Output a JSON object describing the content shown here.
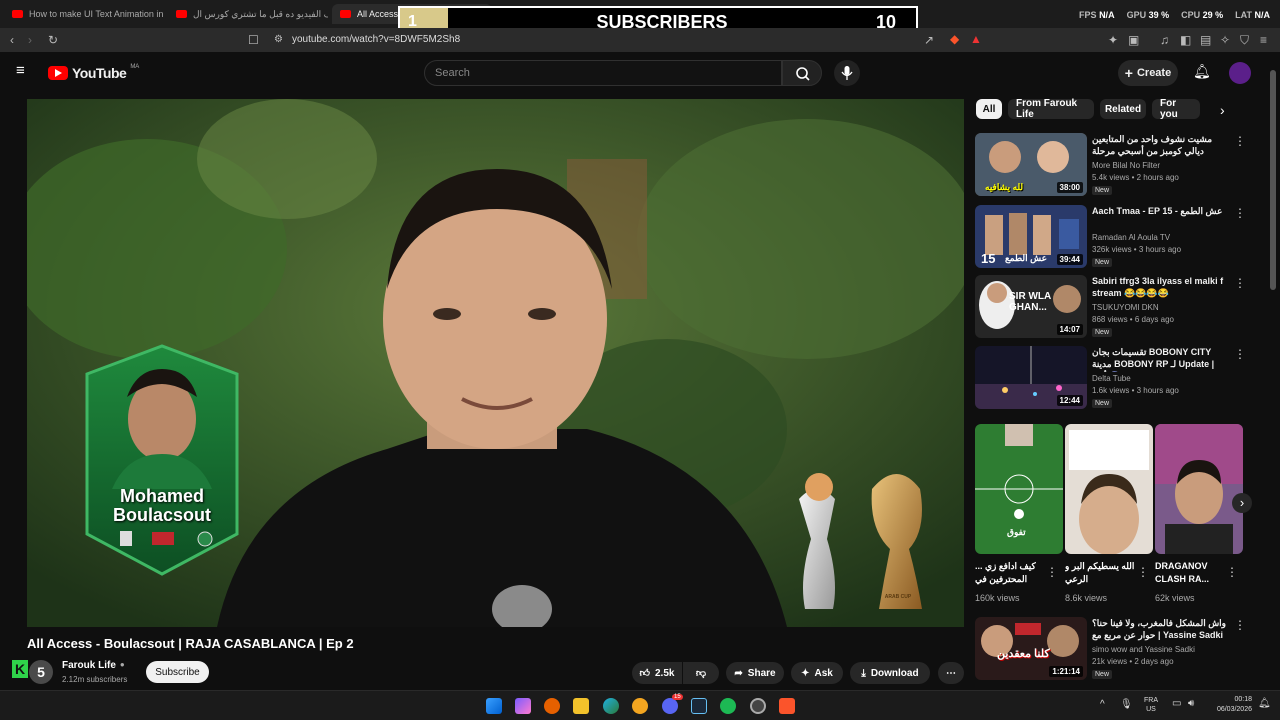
{
  "browser": {
    "tabs": [
      {
        "label": "How to make UI Text Animation in Af",
        "active": false
      },
      {
        "label": "شوف الفيديو ده قبل ما تشتري كورس ال",
        "active": false
      },
      {
        "label": "All Access - B... RAJA C",
        "active": true
      }
    ],
    "url": "youtube.com/watch?v=8DWF5M2Sh8"
  },
  "overlay": {
    "count": "1",
    "title": "SUBSCRIBERS",
    "goal": "10"
  },
  "perf": {
    "fps_label": "FPS",
    "fps_value": "N/A",
    "gpu_label": "GPU",
    "gpu_value": "39 %",
    "cpu_label": "CPU",
    "cpu_value": "29 %",
    "lat_label": "LAT",
    "lat_value": "N/A"
  },
  "masthead": {
    "logo": "YouTube",
    "country": "MA",
    "search_placeholder": "Search",
    "create_label": "Create"
  },
  "video": {
    "title": "All Access - Boulacsout | RAJA CASABLANCA | Ep 2",
    "player_card_name": "Mohamed Boulacsout",
    "trophy_label": "ARAB CUP",
    "channel_name": "Farouk Life",
    "subscribers": "2.12m subscribers",
    "subscribe_label": "Subscribe",
    "likes": "2.5k",
    "share_label": "Share",
    "ask_label": "Ask",
    "download_label": "Download",
    "avatar_badge": "5"
  },
  "sidebar": {
    "chips": [
      "All",
      "From Farouk Life",
      "Related",
      "For you"
    ],
    "recommendations": [
      {
        "title": "مشيت نشوف واحد من المتابعين ديالي كومبز من أسبحي مرحلة خطيرة",
        "channel": "More Bilal No Filter",
        "meta": "5.4k views • 2 hours ago",
        "duration": "38:00",
        "badge": "New",
        "thumb_text": "لله يشافيه",
        "color": "#5a4a3a"
      },
      {
        "title": "Aach Tmaa - EP 15 - عش الطمع",
        "channel": "Ramadan Al Aoula TV",
        "meta": "326k views • 3 hours ago",
        "duration": "39:44",
        "badge": "New",
        "thumb_text": "عش الطمع",
        "color": "#2a3a6a"
      },
      {
        "title": "Sabiri tfrg3 3la ilyass el malki f stream 😂😂😂😂",
        "channel": "TSUKUYOMI DKN",
        "meta": "868 views • 6 days ago",
        "duration": "14:07",
        "badge": "New",
        "thumb_text": "SIR WLA GHAN...",
        "color": "#2a2a2a"
      },
      {
        "title": "تقسيمات بجان BOBONY CITY مدينة BOBONY RP لـ Update | أكبر 😱",
        "channel": "Delta Tube",
        "meta": "1.6k views • 3 hours ago",
        "duration": "12:44",
        "badge": "New",
        "thumb_text": "",
        "color": "#1a1a2a"
      },
      {
        "title": "واش المشكل فالمغرب، ولا فينا حنا؟ | حوار عن مربع مع Yassine Sadki",
        "channel": "simo wow and Yassine Sadki",
        "meta": "21k views • 2 days ago",
        "duration": "1:21:14",
        "badge": "New",
        "thumb_text": "كلنا معقدين",
        "color": "#3a1a1a"
      }
    ],
    "shorts": [
      {
        "title": "كيف ادافع زي ... المحترفين في",
        "views": "160k views",
        "color": "#2e7d32",
        "thumb_text": "تفوق"
      },
      {
        "title": "الله يسطيكم البر و الرعي",
        "views": "8.6k views",
        "color": "#d8d0c8",
        "thumb_text": ""
      },
      {
        "title": "DRAGANOV CLASH RA...",
        "views": "62k views",
        "color": "#7a5a8a",
        "thumb_text": ""
      }
    ]
  },
  "taskbar": {
    "lang": "FRA",
    "lang2": "US",
    "time": "00:18",
    "date": "06/03/2026",
    "discord_badge": "15"
  }
}
